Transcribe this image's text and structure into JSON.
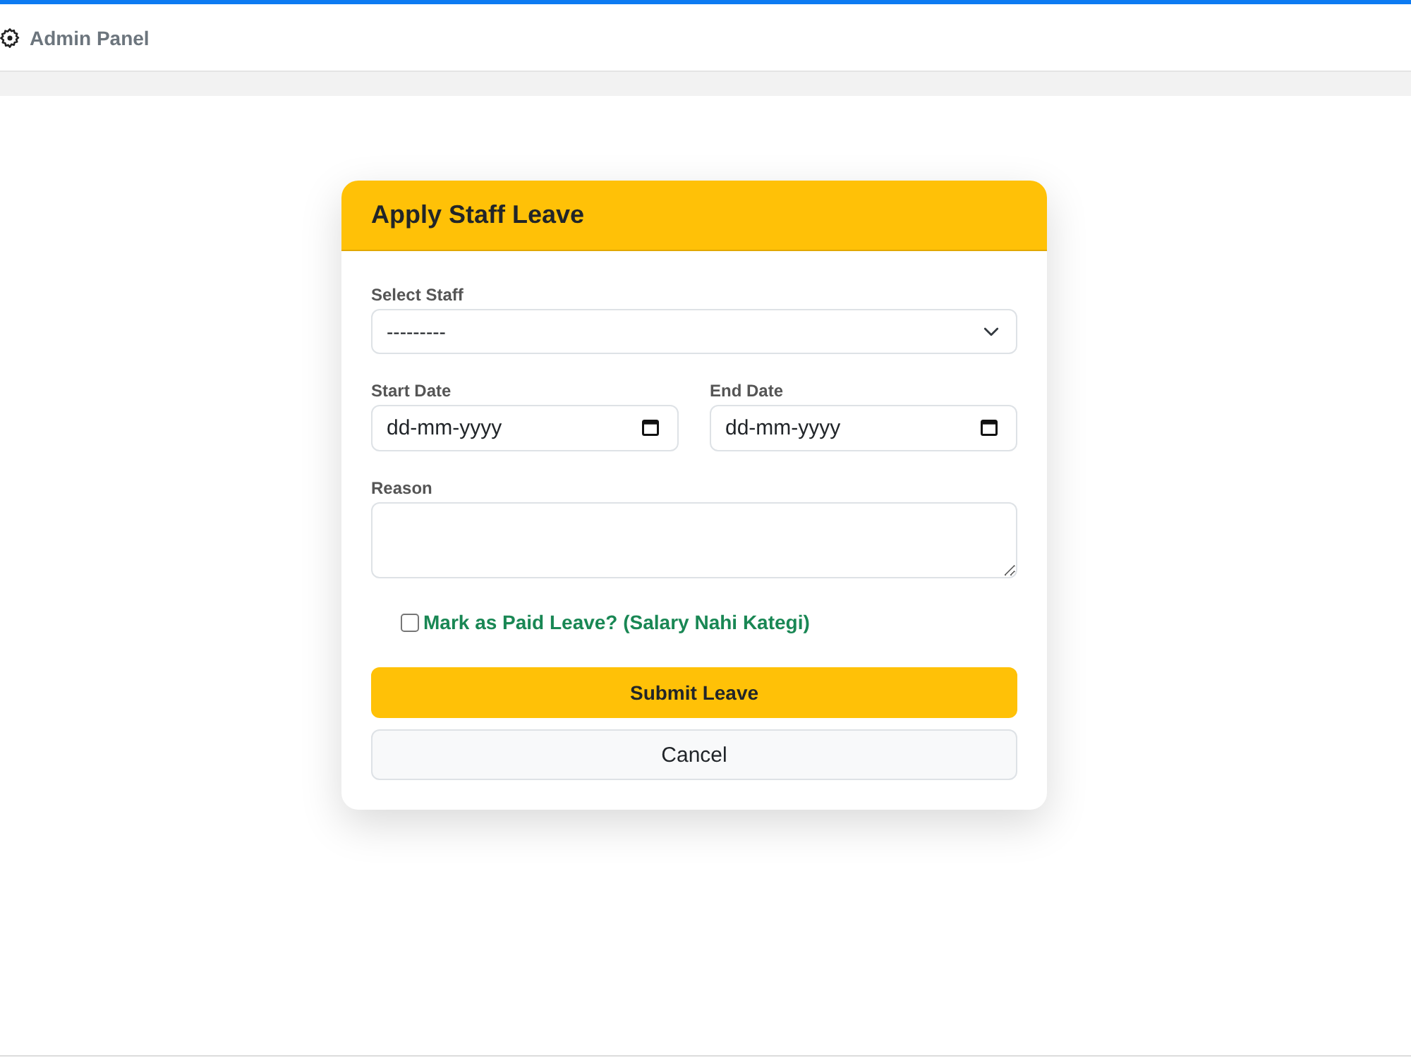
{
  "navbar": {
    "brand": "Admin Panel"
  },
  "form": {
    "title": "Apply Staff Leave",
    "fields": [
      {
        "kind": "select",
        "label": "Select Staff",
        "value": "---------"
      },
      {
        "kind": "date",
        "label": "Start Date",
        "placeholder": "dd-mm-yyyy"
      },
      {
        "kind": "date",
        "label": "End Date",
        "placeholder": "dd-mm-yyyy"
      },
      {
        "kind": "textarea",
        "label": "Reason"
      }
    ],
    "paid_leave": {
      "label": "Mark as Paid Leave? (Salary Nahi Kategi)",
      "checked": false
    },
    "buttons": [
      {
        "kind": "primary",
        "label": "Submit Leave"
      },
      {
        "kind": "secondary",
        "label": "Cancel"
      }
    ]
  }
}
